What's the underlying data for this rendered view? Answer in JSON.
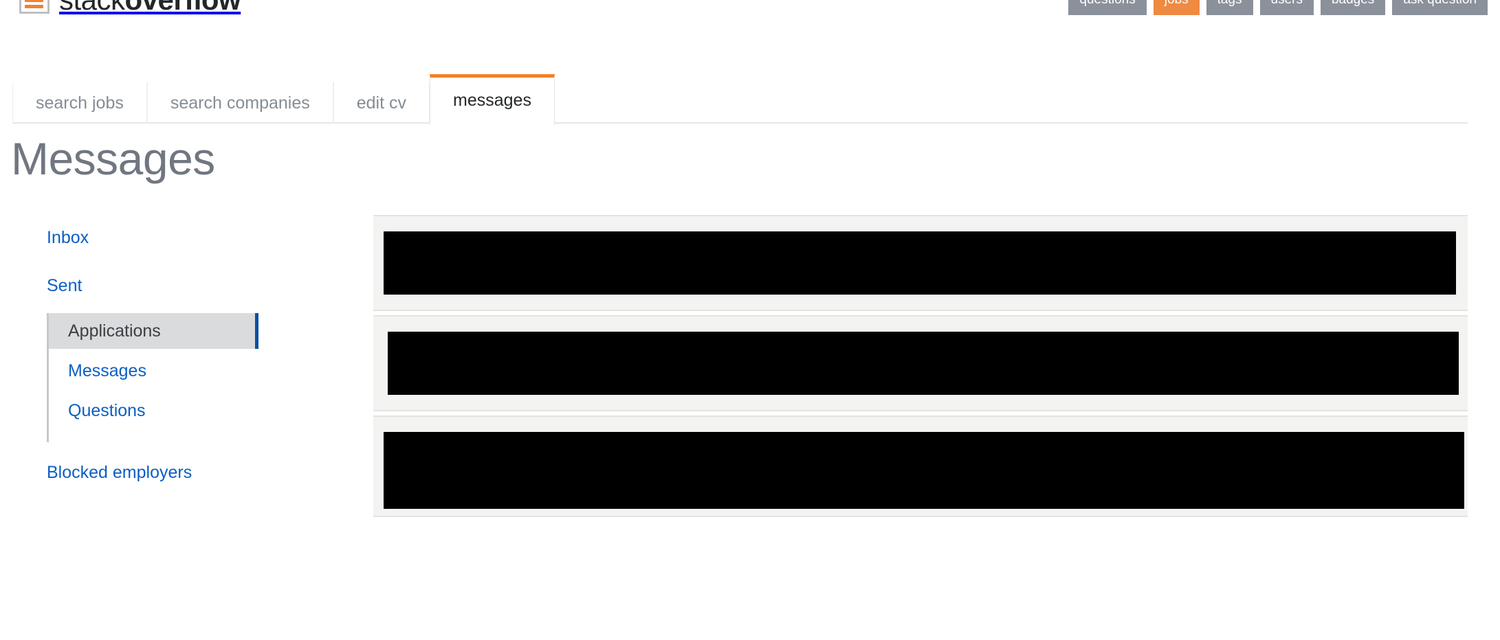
{
  "header": {
    "brand_prefix": "stack",
    "brand_suffix": "overflow",
    "logo_icon": "stack-overflow-logo-icon",
    "nav_items": [
      {
        "label": "questions",
        "style": "default"
      },
      {
        "label": "jobs",
        "style": "accent"
      },
      {
        "label": "tags",
        "style": "default"
      },
      {
        "label": "users",
        "style": "default"
      },
      {
        "label": "badges",
        "style": "default"
      },
      {
        "label": "ask question",
        "style": "default"
      }
    ]
  },
  "tabs": [
    {
      "label": "search jobs",
      "active": false
    },
    {
      "label": "search companies",
      "active": false
    },
    {
      "label": "edit cv",
      "active": false
    },
    {
      "label": "messages",
      "active": true
    }
  ],
  "page": {
    "title": "Messages"
  },
  "sidebar": {
    "inbox": "Inbox",
    "sent": "Sent",
    "sub_items": [
      {
        "label": "Applications",
        "active": true
      },
      {
        "label": "Messages",
        "active": false
      },
      {
        "label": "Questions",
        "active": false
      }
    ],
    "blocked_employers": "Blocked employers"
  },
  "messages": {
    "rows": [
      {
        "redacted": true
      },
      {
        "redacted": true
      },
      {
        "redacted": true
      }
    ]
  },
  "colors": {
    "accent_orange": "#f48024",
    "nav_button_gray": "#8b919b",
    "nav_button_orange": "#ef8a43",
    "link_blue": "#0c5fc4",
    "active_bar_blue": "#0a50a1",
    "active_item_bg": "#d9dbdd",
    "title_gray": "#717781",
    "row_bg": "#f3f3f1",
    "row_border": "#e3e4e0",
    "redaction_black": "#000000"
  }
}
